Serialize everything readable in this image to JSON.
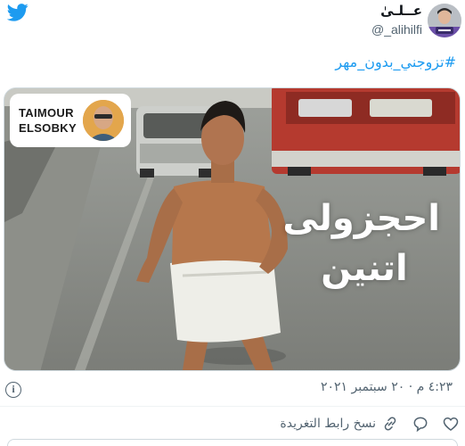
{
  "tweet": {
    "author_name": "عــلـىٰ",
    "author_handle": "@_alihilfi",
    "hashtag": "#تزوجني_بدون_مهر",
    "timestamp": "٤:٢٣ م · ٢٠ سبتمبر ٢٠٢١",
    "media": {
      "brand_label_line1": "TAIMOUR",
      "brand_label_line2": "ELSOBKY",
      "caption_line1": "احجزولى",
      "caption_line2": "اتنين"
    },
    "actions": {
      "copy_link_label": "نسخ رابط التغريدة"
    }
  },
  "icons": {
    "logo": "twitter-bird-icon",
    "info": "info-icon",
    "like": "heart-icon",
    "reply": "reply-bubble-icon",
    "link": "link-icon"
  },
  "colors": {
    "accent": "#1d9bf0",
    "muted": "#536471",
    "text": "#0f1419"
  }
}
